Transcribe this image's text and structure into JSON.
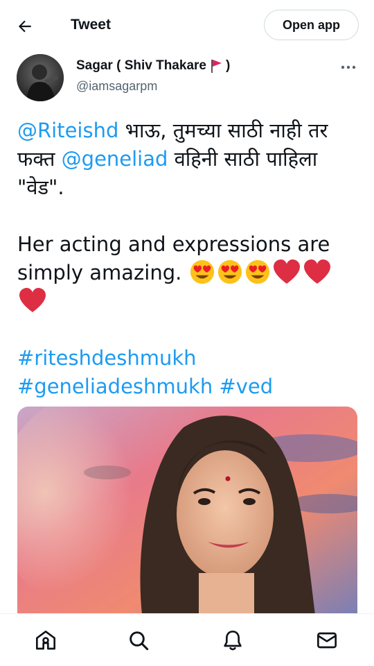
{
  "header": {
    "title": "Tweet",
    "open_app_label": "Open app",
    "back_icon": "arrow-left-icon"
  },
  "author": {
    "name": "Sagar ( Shiv Thakare",
    "name_suffix": ")",
    "flag_icon": "red-flag-emoji",
    "handle": "@iamsagarpm"
  },
  "tweet": {
    "mention1": "@Riteishd",
    "line1_rest": " भाऊ, तुमच्या साठी नाही तर",
    "line2_pre": "फक्त ",
    "mention2": "@geneliad",
    "line2_rest": " वहिनी साठी पाहिला",
    "line3": "\"वेड\".",
    "para2": "Her acting and expressions are simply amazing. ",
    "emojis": [
      "heart-eyes-emoji",
      "heart-eyes-emoji",
      "heart-eyes-emoji",
      "red-heart-emoji",
      "red-heart-emoji",
      "red-heart-emoji"
    ],
    "hashtag1": "#riteshdeshmukh",
    "hashtag2": "#geneliadeshmukh",
    "hashtag3": "#ved"
  },
  "nav": {
    "items": [
      "home-icon",
      "search-icon",
      "notifications-bell-icon",
      "messages-envelope-icon"
    ]
  },
  "colors": {
    "link": "#1d9bf0",
    "text": "#0f1419",
    "secondary": "#536471",
    "border": "#cfd9de"
  }
}
